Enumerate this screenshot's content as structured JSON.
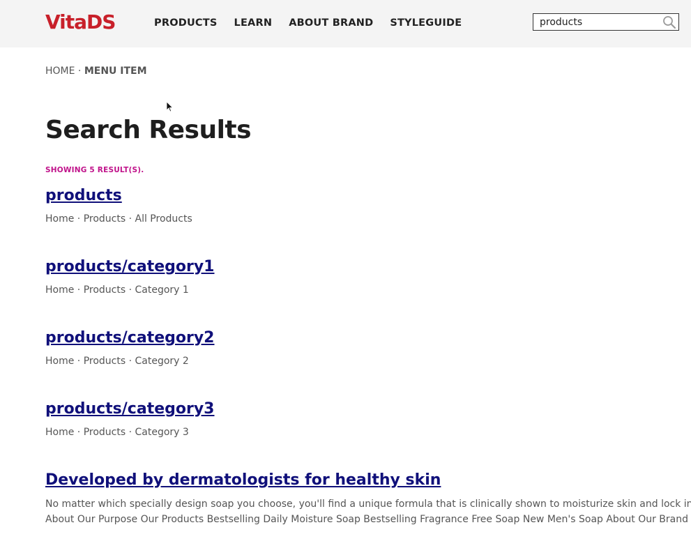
{
  "header": {
    "logo": "VitaDS",
    "nav": [
      "PRODUCTS",
      "LEARN",
      "ABOUT BRAND",
      "STYLEGUIDE"
    ],
    "search_value": "products",
    "search_icon": "search-icon"
  },
  "breadcrumb": {
    "home": "HOME",
    "separator": " · ",
    "current": "MENU ITEM"
  },
  "page_title": "Search Results",
  "results_count": "SHOWING 5 RESULT(S).",
  "results": [
    {
      "title": "products",
      "path": "Home · Products · All Products"
    },
    {
      "title": "products/category1",
      "path": "Home · Products · Category 1"
    },
    {
      "title": "products/category2",
      "path": "Home · Products · Category 2"
    },
    {
      "title": "products/category3",
      "path": "Home · Products · Category 3"
    },
    {
      "title": "Developed by dermatologists for healthy skin",
      "snippet_line1": "No matter which specially design soap you choose, you'll find a unique formula that is clinically shown to moisturize skin and lock in moisture",
      "snippet_line2": "About Our Purpose Our Products Bestselling Daily Moisture Soap Bestselling Fragrance Free Soap New Men's Soap About Our Brand"
    }
  ],
  "colors": {
    "brand": "#c8202a",
    "link": "#10107a",
    "accent": "#c0128a",
    "header_bg": "#f4f4f4"
  }
}
